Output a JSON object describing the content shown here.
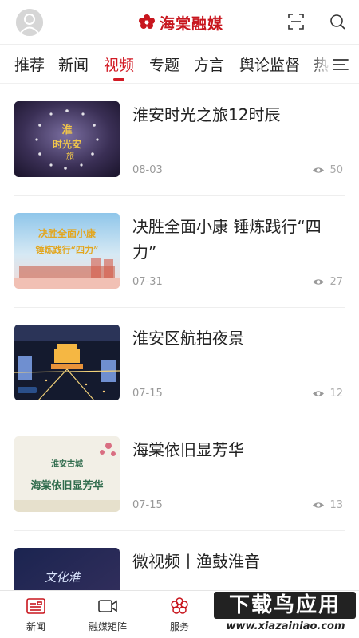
{
  "header": {
    "logo_text": "海棠融媒",
    "icons": [
      "avatar",
      "scan-icon",
      "search-icon"
    ]
  },
  "tabs": [
    {
      "label": "推荐",
      "active": false
    },
    {
      "label": "新闻",
      "active": false
    },
    {
      "label": "视频",
      "active": true
    },
    {
      "label": "专题",
      "active": false
    },
    {
      "label": "方言",
      "active": false
    },
    {
      "label": "舆论监督",
      "active": false
    },
    {
      "label": "热",
      "active": false
    }
  ],
  "list": [
    {
      "title": "淮安时光之旅12时辰",
      "date": "08-03",
      "views": "50",
      "thumb_text": "淮安时光之旅"
    },
    {
      "title": "决胜全面小康 锤炼践行“四力”",
      "date": "07-31",
      "views": "27",
      "thumb_text_1": "决胜全面小康",
      "thumb_text_2": "锤炼践行“四力”"
    },
    {
      "title": "淮安区航拍夜景",
      "date": "07-15",
      "views": "12"
    },
    {
      "title": "海棠依旧显芳华",
      "date": "07-15",
      "views": "13",
      "thumb_text_1": "淮安古城",
      "thumb_text_2": "海棠依旧显芳华"
    },
    {
      "title": "微视频丨渔鼓淮音",
      "thumb_text": "文化淮"
    }
  ],
  "bottom_nav": [
    {
      "label": "新闻",
      "icon": "news-icon",
      "active": true
    },
    {
      "label": "融媒矩阵",
      "icon": "video-camera-icon",
      "active": false
    },
    {
      "label": "服务",
      "icon": "flower-icon",
      "active": false
    }
  ],
  "watermark": {
    "top": "下载鸟应用",
    "bottom": "www.xiazainiao.com"
  },
  "colors": {
    "accent": "#d21a24",
    "text": "#222222",
    "muted": "#999999"
  }
}
